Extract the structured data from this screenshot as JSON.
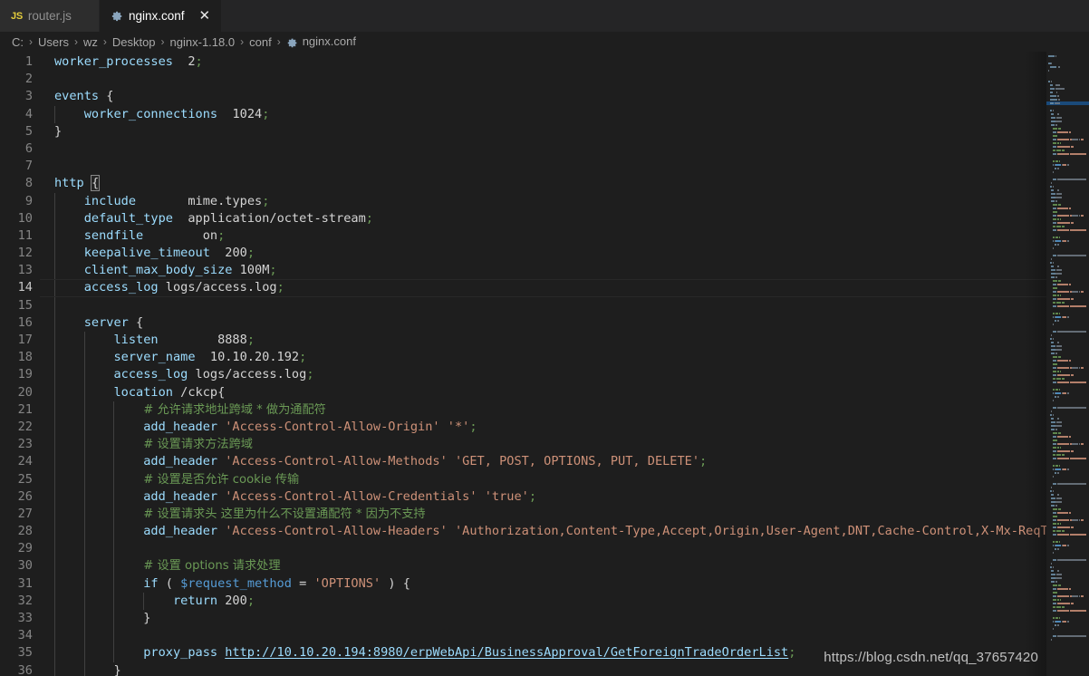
{
  "tabs": [
    {
      "label": "router.js",
      "icon": "js-file-icon",
      "active": false,
      "closable": false
    },
    {
      "label": "nginx.conf",
      "icon": "gear-file-icon",
      "active": true,
      "closable": true,
      "close_label": "✕"
    }
  ],
  "breadcrumb": {
    "separator": "›",
    "items": [
      {
        "label": "C:",
        "icon": null
      },
      {
        "label": "Users",
        "icon": null
      },
      {
        "label": "wz",
        "icon": null
      },
      {
        "label": "Desktop",
        "icon": null
      },
      {
        "label": "nginx-1.18.0",
        "icon": null
      },
      {
        "label": "conf",
        "icon": null
      },
      {
        "label": "nginx.conf",
        "icon": "gear-file-icon"
      }
    ]
  },
  "editor": {
    "active_line": 14,
    "language": "nginx",
    "lines": [
      {
        "n": 1,
        "text": "worker_processes  2;"
      },
      {
        "n": 2,
        "text": ""
      },
      {
        "n": 3,
        "text": "events {"
      },
      {
        "n": 4,
        "text": "    worker_connections  1024;"
      },
      {
        "n": 5,
        "text": "}"
      },
      {
        "n": 6,
        "text": ""
      },
      {
        "n": 7,
        "text": ""
      },
      {
        "n": 8,
        "text": "http {"
      },
      {
        "n": 9,
        "text": "    include       mime.types;"
      },
      {
        "n": 10,
        "text": "    default_type  application/octet-stream;"
      },
      {
        "n": 11,
        "text": "    sendfile        on;"
      },
      {
        "n": 12,
        "text": "    keepalive_timeout  200;"
      },
      {
        "n": 13,
        "text": "    client_max_body_size 100M;"
      },
      {
        "n": 14,
        "text": "    access_log logs/access.log;"
      },
      {
        "n": 15,
        "text": ""
      },
      {
        "n": 16,
        "text": "    server {"
      },
      {
        "n": 17,
        "text": "        listen        8888;"
      },
      {
        "n": 18,
        "text": "        server_name  10.10.20.192;"
      },
      {
        "n": 19,
        "text": "        access_log logs/access.log;"
      },
      {
        "n": 20,
        "text": "        location /ckcp{"
      },
      {
        "n": 21,
        "text": "            # 允许请求地址跨域 * 做为通配符"
      },
      {
        "n": 22,
        "text": "            add_header 'Access-Control-Allow-Origin' '*';"
      },
      {
        "n": 23,
        "text": "            # 设置请求方法跨域"
      },
      {
        "n": 24,
        "text": "            add_header 'Access-Control-Allow-Methods' 'GET, POST, OPTIONS, PUT, DELETE';"
      },
      {
        "n": 25,
        "text": "            # 设置是否允许 cookie 传输"
      },
      {
        "n": 26,
        "text": "            add_header 'Access-Control-Allow-Credentials' 'true';"
      },
      {
        "n": 27,
        "text": "            # 设置请求头 这里为什么不设置通配符 * 因为不支持"
      },
      {
        "n": 28,
        "text": "            add_header 'Access-Control-Allow-Headers' 'Authorization,Content-Type,Accept,Origin,User-Agent,DNT,Cache-Control,X-Mx-ReqToken,X-D"
      },
      {
        "n": 29,
        "text": ""
      },
      {
        "n": 30,
        "text": "            # 设置 options 请求处理"
      },
      {
        "n": 31,
        "text": "            if ( $request_method = 'OPTIONS' ) {"
      },
      {
        "n": 32,
        "text": "                return 200;"
      },
      {
        "n": 33,
        "text": "            }"
      },
      {
        "n": 34,
        "text": ""
      },
      {
        "n": 35,
        "text": "            proxy_pass http://10.10.20.194:8980/erpWebApi/BusinessApproval/GetForeignTradeOrderList;"
      },
      {
        "n": 36,
        "text": "        }"
      }
    ]
  },
  "watermark": {
    "text": "https://blog.csdn.net/qq_37657420"
  },
  "colors": {
    "background": "#1e1e1e",
    "tabbar": "#252526",
    "tab_inactive": "#2d2d2d",
    "comment": "#6a9955",
    "string": "#ce9178",
    "directive": "#9cdcfe",
    "variable": "#569cd6",
    "text": "#d4d4d4",
    "linenumber": "#858585",
    "linenumber_active": "#c6c6c6",
    "js_icon": "#e4cd3c",
    "gear_icon": "#8aa5bd",
    "minimap_active": "#1a4a7a"
  }
}
